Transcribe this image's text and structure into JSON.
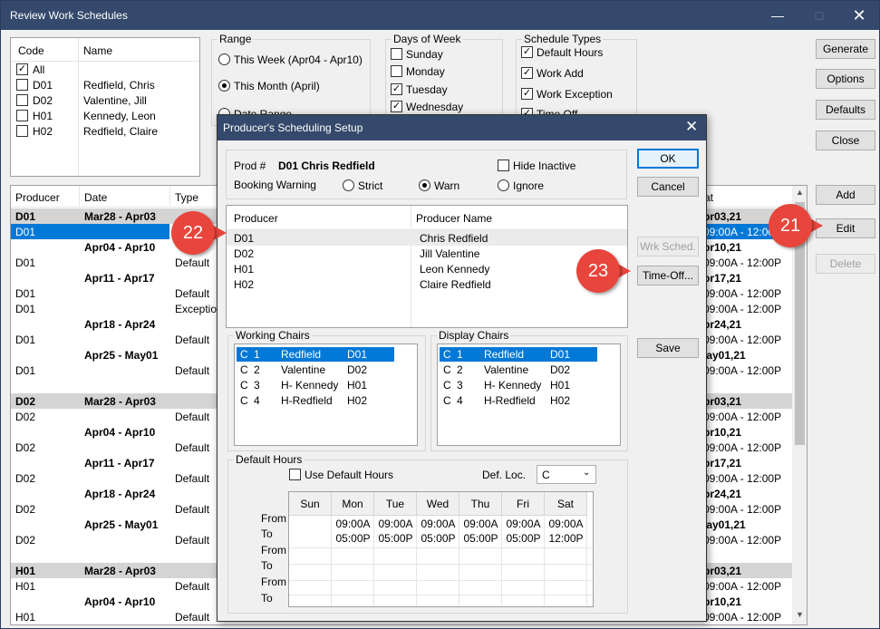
{
  "window": {
    "title": "Review Work Schedules"
  },
  "code_list": {
    "col_code": "Code",
    "col_name": "Name",
    "all": "All",
    "items": [
      {
        "code": "D01",
        "name": "Redfield, Chris"
      },
      {
        "code": "D02",
        "name": "Valentine, Jill"
      },
      {
        "code": "H01",
        "name": "Kennedy, Leon"
      },
      {
        "code": "H02",
        "name": "Redfield, Claire"
      }
    ]
  },
  "range": {
    "label": "Range",
    "this_week": "This Week (Apr04 - Apr10)",
    "this_month": "This Month (April)",
    "date_range": "Date Range"
  },
  "days": {
    "label": "Days of Week",
    "sunday": "Sunday",
    "monday": "Monday",
    "tuesday": "Tuesday",
    "wednesday": "Wednesday"
  },
  "types": {
    "label": "Schedule Types",
    "default": "Default Hours",
    "work_add": "Work Add",
    "work_exception": "Work Exception",
    "time_off": "Time Off"
  },
  "right_buttons": {
    "generate": "Generate",
    "options": "Options",
    "defaults": "Defaults",
    "close": "Close",
    "add": "Add",
    "edit": "Edit",
    "delete": "Delete"
  },
  "grid": {
    "col_producer": "Producer",
    "col_date": "Date",
    "col_type": "Type",
    "col_right": "at",
    "rows": [
      {
        "p": "D01",
        "d": "Mar28 - Apr03",
        "t": "",
        "r": "pr03,21",
        "g": true
      },
      {
        "p": "D01",
        "d": "",
        "t": "",
        "r": "09:00A - 12:00P",
        "sel": true
      },
      {
        "p": "",
        "d": "Apr04 - Apr10",
        "t": "",
        "r": "pr10,21"
      },
      {
        "p": "D01",
        "d": "",
        "t": "Default",
        "r": "09:00A - 12:00P"
      },
      {
        "p": "",
        "d": "Apr11 - Apr17",
        "t": "",
        "r": "pr17,21"
      },
      {
        "p": "D01",
        "d": "",
        "t": "Default",
        "r": "09:00A - 12:00P"
      },
      {
        "p": "D01",
        "d": "",
        "t": "Exception",
        "r": "09:00A - 12:00P"
      },
      {
        "p": "",
        "d": "Apr18 - Apr24",
        "t": "",
        "r": "pr24,21"
      },
      {
        "p": "D01",
        "d": "",
        "t": "Default",
        "r": "09:00A - 12:00P"
      },
      {
        "p": "",
        "d": "Apr25 - May01",
        "t": "",
        "r": "lay01,21"
      },
      {
        "p": "D01",
        "d": "",
        "t": "Default",
        "r": "09:00A - 12:00P"
      },
      {
        "p": "",
        "d": "",
        "t": "",
        "r": ""
      },
      {
        "p": "D02",
        "d": "Mar28 - Apr03",
        "t": "",
        "r": "pr03,21",
        "g": true
      },
      {
        "p": "D02",
        "d": "",
        "t": "Default",
        "r": "09:00A - 12:00P"
      },
      {
        "p": "",
        "d": "Apr04 - Apr10",
        "t": "",
        "r": "pr10,21"
      },
      {
        "p": "D02",
        "d": "",
        "t": "Default",
        "r": "09:00A - 12:00P"
      },
      {
        "p": "",
        "d": "Apr11 - Apr17",
        "t": "",
        "r": "pr17,21"
      },
      {
        "p": "D02",
        "d": "",
        "t": "Default",
        "r": "09:00A - 12:00P"
      },
      {
        "p": "",
        "d": "Apr18 - Apr24",
        "t": "",
        "r": "pr24,21"
      },
      {
        "p": "D02",
        "d": "",
        "t": "Default",
        "r": "09:00A - 12:00P"
      },
      {
        "p": "",
        "d": "Apr25 - May01",
        "t": "",
        "r": "lay01,21"
      },
      {
        "p": "D02",
        "d": "",
        "t": "Default",
        "r": "09:00A - 12:00P"
      },
      {
        "p": "",
        "d": "",
        "t": "",
        "r": ""
      },
      {
        "p": "H01",
        "d": "Mar28 - Apr03",
        "t": "",
        "r": "pr03,21",
        "g": true
      },
      {
        "p": "H01",
        "d": "",
        "t": "Default",
        "r": "09:00A - 12:00P"
      },
      {
        "p": "",
        "d": "Apr04 - Apr10",
        "t": "",
        "r": "pr10,21"
      },
      {
        "p": "H01",
        "d": "",
        "t": "Default",
        "r": "09:00A - 12:00P"
      }
    ]
  },
  "dialog": {
    "title": "Producer's Scheduling Setup",
    "prod_label": "Prod #",
    "prod_value": "D01 Chris Redfield",
    "hide_inactive": "Hide Inactive",
    "booking_warning": "Booking Warning",
    "strict": "Strict",
    "warn": "Warn",
    "ignore": "Ignore",
    "ok": "OK",
    "cancel": "Cancel",
    "wrk_sched": "Wrk Sched.",
    "time_off": "Time-Off...",
    "save": "Save",
    "col_producer": "Producer",
    "col_producer_name": "Producer Name",
    "producers": [
      {
        "code": "D01",
        "name": "Chris Redfield"
      },
      {
        "code": "D02",
        "name": "Jill Valentine"
      },
      {
        "code": "H01",
        "name": "Leon Kennedy"
      },
      {
        "code": "H02",
        "name": "Claire Redfield"
      }
    ],
    "working_chairs_label": "Working Chairs",
    "display_chairs_label": "Display Chairs",
    "chairs": [
      {
        "c": "C",
        "n": "1",
        "name": "Redfield",
        "code": "D01"
      },
      {
        "c": "C",
        "n": "2",
        "name": "Valentine",
        "code": "D02"
      },
      {
        "c": "C",
        "n": "3",
        "name": "H- Kennedy",
        "code": "H01"
      },
      {
        "c": "C",
        "n": "4",
        "name": "H-Redfield",
        "code": "H02"
      }
    ],
    "default_hours_label": "Default Hours",
    "use_default_hours": "Use Default Hours",
    "def_loc_label": "Def. Loc.",
    "def_loc_value": "C",
    "days": [
      "Sun",
      "Mon",
      "Tue",
      "Wed",
      "Thu",
      "Fri",
      "Sat"
    ],
    "from_label": "From",
    "to_label": "To",
    "from_times": [
      "",
      "09:00A",
      "09:00A",
      "09:00A",
      "09:00A",
      "09:00A",
      "09:00A"
    ],
    "to_times": [
      "",
      "05:00P",
      "05:00P",
      "05:00P",
      "05:00P",
      "05:00P",
      "12:00P"
    ]
  },
  "callouts": {
    "c21": "21",
    "c22": "22",
    "c23": "23"
  },
  "colors": {
    "accent": "#0078d7",
    "titlebar": "#34496b",
    "callout": "#e8453c"
  }
}
